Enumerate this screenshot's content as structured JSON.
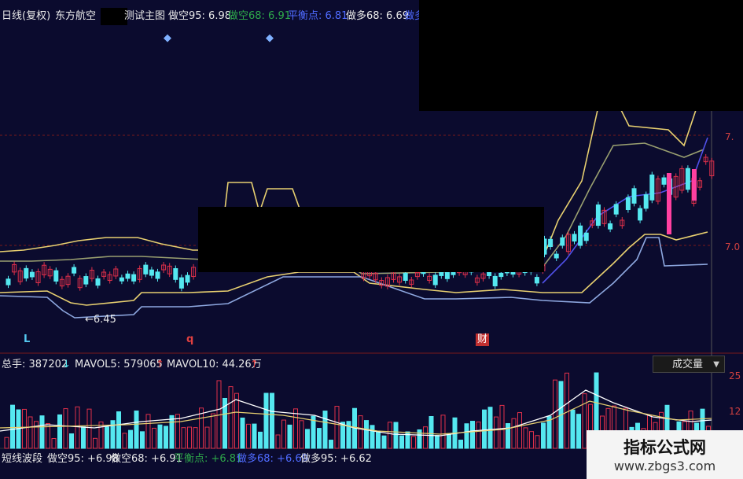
{
  "header": {
    "period": "日线(复权)",
    "stock": "东方航空",
    "indicator": "测试主图",
    "items": [
      {
        "label": "做空95: 6.98",
        "color": "#e8e8e8"
      },
      {
        "label": "做空68: 6.91",
        "color": "#2ea84a"
      },
      {
        "label": "平衡点: 6.81",
        "color": "#4f6bff"
      },
      {
        "label": "做多68: 6.69",
        "color": "#e8e8e8"
      },
      {
        "label": "做多",
        "color": "#4f6bff"
      }
    ]
  },
  "main": {
    "y_ticks": [
      "7.",
      "7.0"
    ],
    "low_marker": "←6.45",
    "markers": [
      "L",
      "q",
      "财"
    ]
  },
  "volume": {
    "zongshou": "总手: 387202",
    "zongshou_arrow": "↓",
    "mavol5": "MAVOL5: 579065",
    "mavol5_arrow": "↑",
    "mavol10": "MAVOL10: 44.26万",
    "mavol10_arrow": "↑",
    "y_ticks": [
      "25",
      "12"
    ],
    "select_label": "成交量"
  },
  "footer": {
    "items": [
      {
        "label": "短线波段",
        "color": "#e8e8e8"
      },
      {
        "label": "做空95: +6.98",
        "color": "#e8e8e8"
      },
      {
        "label": "做空68: +6.91",
        "color": "#e8e8e8"
      },
      {
        "label": "平衡点: +6.81",
        "color": "#2ea84a"
      },
      {
        "label": "做多68: +6.69",
        "color": "#4f6bff"
      },
      {
        "label": "做多95: +6.62",
        "color": "#e8e8e8"
      }
    ]
  },
  "watermark": {
    "title": "指标公式网",
    "url": "www.zbgs3.com"
  },
  "colors": {
    "background": "#0b0b2e",
    "up": "#e0304a",
    "down": "#55e8f0",
    "band_yellow": "#e8d070",
    "band_green": "#9aa070",
    "band_blue": "#8ea8e0",
    "mid_line": "#5050e8",
    "grid_red": "#7a1a1a"
  }
}
